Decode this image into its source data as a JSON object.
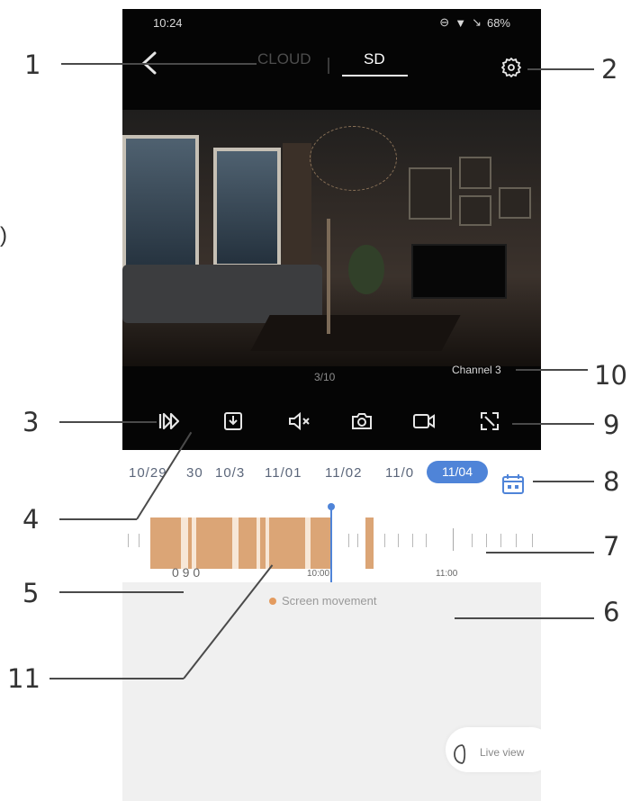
{
  "status_bar": {
    "time": "10:24",
    "battery": "68%",
    "icons": [
      "do-not-disturb-icon",
      "wifi-icon",
      "signal-icon"
    ]
  },
  "header": {
    "back_icon": "back-arrow-icon",
    "tabs": [
      {
        "label": "CLOUD",
        "selected": false
      },
      {
        "label": "SD",
        "selected": true
      }
    ],
    "settings_icon": "gear-icon"
  },
  "video": {
    "counter": "3/10",
    "channel": "Channel 3"
  },
  "controls": [
    {
      "icon": "play-speed-icon"
    },
    {
      "icon": "download-icon"
    },
    {
      "icon": "mute-icon"
    },
    {
      "icon": "camera-icon"
    },
    {
      "icon": "video-record-icon"
    },
    {
      "icon": "fullscreen-icon"
    }
  ],
  "dates": {
    "items": [
      "10/29",
      "30",
      "10/3",
      "11/01",
      "11/02",
      "11/0"
    ],
    "selected": "11/04",
    "calendar_icon": "calendar-icon"
  },
  "timeline": {
    "labels": [
      "0 9 0",
      "10:00",
      "11:00"
    ],
    "legend": "Screen movement"
  },
  "live_view": {
    "label": "Live view",
    "icon": "live-view-icon"
  },
  "callouts": [
    "1",
    "2",
    "3",
    "4",
    "5",
    "6",
    "7",
    "8",
    "9",
    "10",
    "11"
  ],
  "partial_paren": ")"
}
